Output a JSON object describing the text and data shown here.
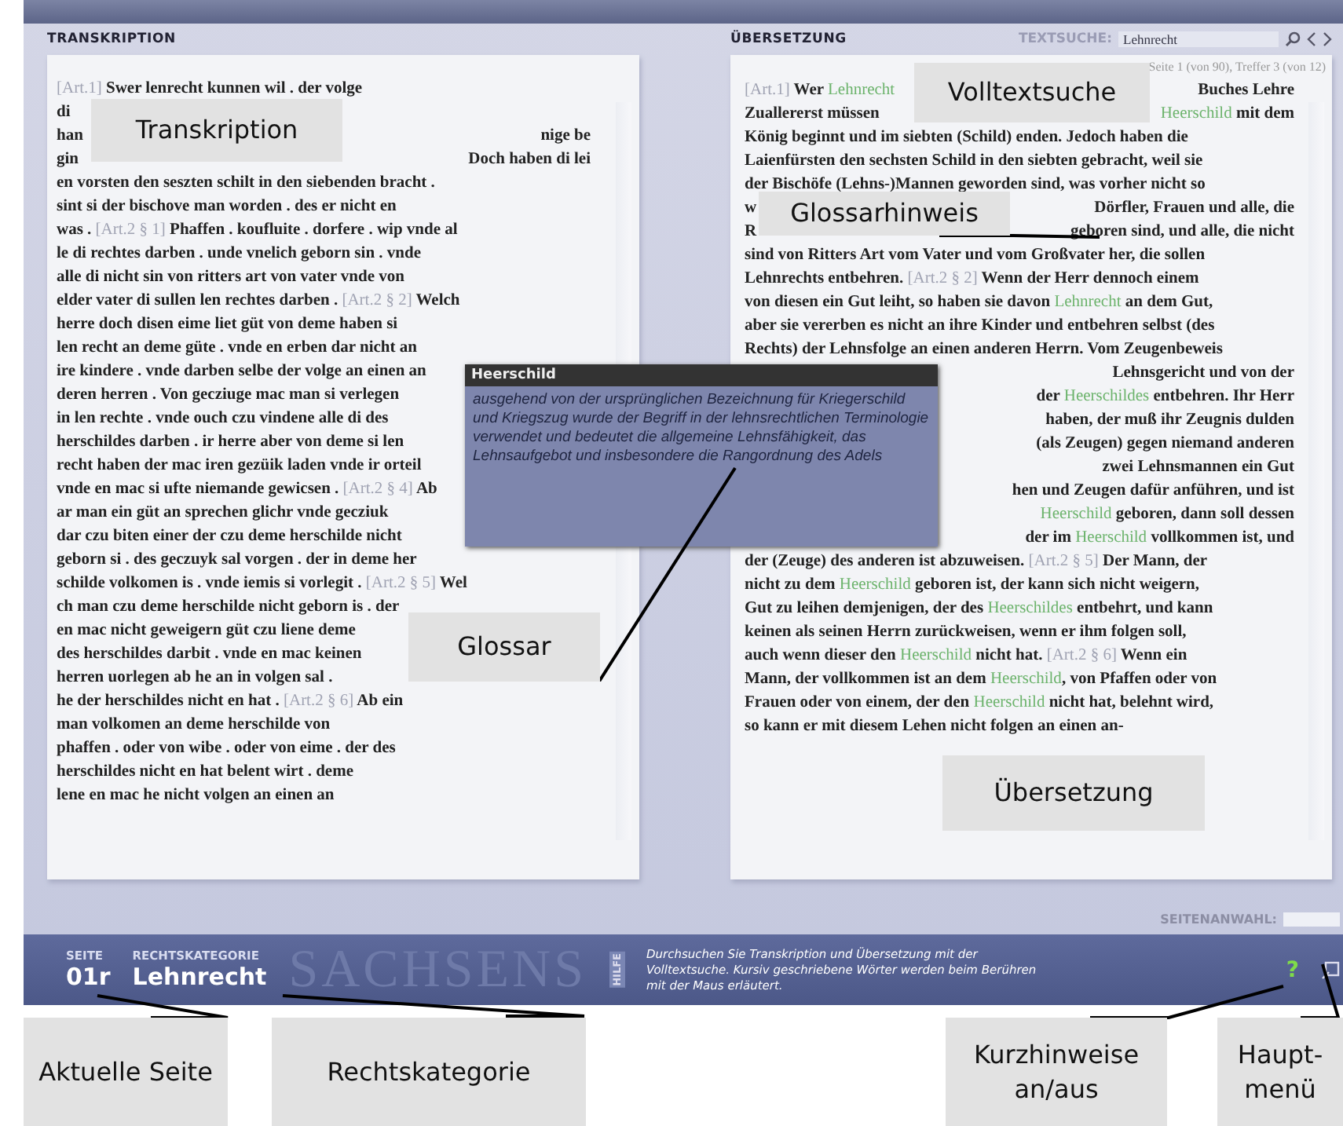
{
  "transcription": {
    "title": "TRANSKRIPTION",
    "lines": [
      [
        {
          "kind": "ref",
          "text": "[Art.1]"
        },
        " Swer lenrecht kunnen wil . der volge"
      ],
      [
        "di",
        {
          "kind": "gap"
        }
      ],
      [
        "han",
        {
          "kind": "gap"
        },
        "nige be"
      ],
      [
        "gin",
        {
          "kind": "gap"
        },
        "Doch haben di lei"
      ],
      [
        "en vorsten den seszten schilt in den siebenden bracht ."
      ],
      [
        "sint si der bischove man worden . des er nicht en"
      ],
      [
        "was . ",
        {
          "kind": "ref",
          "text": "[Art.2 § 1]"
        },
        " Phaffen . koufluite . dorfere . wip vnde al"
      ],
      [
        "le di rechtes darben . unde vnelich geborn sin . vnde"
      ],
      [
        "alle di nicht sin von ritters art von vater vnde von"
      ],
      [
        "elder vater di sullen len rechtes darben . ",
        {
          "kind": "ref",
          "text": "[Art.2 § 2]"
        },
        " Welch"
      ],
      [
        "herre doch disen eime liet güt von deme haben si"
      ],
      [
        "len recht an deme güte . vnde en erben dar nicht an"
      ],
      [
        "ire kindere . vnde darben selbe der volge an einen an"
      ],
      [
        "deren herren . Von gecziuge mac man si verlegen"
      ],
      [
        "in len rechte . vnde ouch czu vindene alle di des"
      ],
      [
        "herschildes darben . ir herre aber von deme si len"
      ],
      [
        "recht haben der mac iren gezüik laden vnde ir orteil"
      ],
      [
        "vnde en mac si ufte niemande gewicsen . ",
        {
          "kind": "ref",
          "text": "[Art.2 § 4]"
        },
        " Ab"
      ],
      [
        "ar man ein güt an sprechen glichr vnde gecziuk"
      ],
      [
        "dar czu biten einer der czu deme herschilde nicht"
      ],
      [
        "geborn si . des geczuyk sal vorgen . der in deme her"
      ],
      [
        "schilde volkomen is . vnde iemis si vorlegit . ",
        {
          "kind": "ref",
          "text": "[Art.2 § 5]"
        },
        " Wel"
      ],
      [
        "ch man czu deme herschilde nicht geborn is . der"
      ],
      [
        "en mac nicht geweigern güt czu liene deme"
      ],
      [
        "des herschildes darbit . vnde en mac keinen"
      ],
      [
        "herren uorlegen ab he an in volgen sal ."
      ],
      [
        "he der herschildes nicht en hat . ",
        {
          "kind": "ref",
          "text": "[Art.2 § 6]"
        },
        " Ab ein"
      ],
      [
        "man volkomen an deme herschilde von"
      ],
      [
        "phaffen . oder von wibe . oder von eime . der des"
      ],
      [
        "herschildes nicht en hat belent wirt . deme"
      ],
      [
        "lene en mac he nicht volgen an einen an"
      ]
    ]
  },
  "translation": {
    "title": "ÜBERSETZUNG",
    "search_label": "TEXTSUCHE:",
    "search_value": "Lehnrecht",
    "hits": "Seite 1 (von 90), Treffer 3 (von 12)",
    "lines": [
      [
        {
          "kind": "ref",
          "text": "[Art.1]"
        },
        " Wer ",
        {
          "kind": "gloss",
          "text": "Lehnrecht"
        },
        {
          "kind": "gap"
        },
        "Buches Lehre"
      ],
      [
        "Zuallererst müssen",
        {
          "kind": "gap"
        },
        {
          "kind": "gloss",
          "text": "Heerschild"
        },
        " mit dem"
      ],
      [
        "König beginnt und im siebten (Schild) enden. Jedoch haben die"
      ],
      [
        "Laienfürsten den sechsten Schild in den siebten gebracht, weil sie"
      ],
      [
        "der Bischöfe (Lehns-)Mannen geworden sind, was vorher nicht so"
      ],
      [
        "w",
        {
          "kind": "gap"
        },
        "Dörfler, Frauen und alle, die"
      ],
      [
        "R",
        {
          "kind": "gap"
        },
        "geboren sind, und alle, die nicht"
      ],
      [
        "sind von Ritters Art vom Vater und vom Großvater her, die sollen"
      ],
      [
        "Lehnrechts entbehren. ",
        {
          "kind": "ref",
          "text": "[Art.2 § 2]"
        },
        " Wenn der Herr dennoch einem"
      ],
      [
        "von diesen ein Gut leiht, so haben sie davon ",
        {
          "kind": "gloss",
          "text": "Lehnrecht"
        },
        " an dem Gut,"
      ],
      [
        "aber sie vererben es nicht an ihre Kinder und entbehren selbst (des"
      ],
      [
        "Rechts) der Lehnsfolge an einen anderen Herrn. Vom Zeugenbeweis"
      ],
      [
        {
          "kind": "gap"
        },
        "Lehnsgericht und von der"
      ],
      [
        {
          "kind": "gap"
        },
        "der ",
        {
          "kind": "gloss",
          "text": "Heerschildes"
        },
        " entbehren. Ihr Herr"
      ],
      [
        {
          "kind": "gap"
        },
        "haben, der muß ihr Zeugnis dulden"
      ],
      [
        {
          "kind": "gap"
        },
        "(als Zeugen) gegen niemand anderen"
      ],
      [
        {
          "kind": "gap"
        },
        "zwei Lehnsmannen ein Gut"
      ],
      [
        {
          "kind": "gap"
        },
        "hen und Zeugen dafür anführen, und ist"
      ],
      [
        {
          "kind": "gap"
        },
        {
          "kind": "gloss",
          "text": "Heerschild"
        },
        " geboren, dann soll dessen"
      ],
      [
        {
          "kind": "gap"
        },
        "der im ",
        {
          "kind": "gloss",
          "text": "Heerschild"
        },
        " vollkommen ist, und"
      ],
      [
        "der (Zeuge) des anderen ist abzuweisen. ",
        {
          "kind": "ref",
          "text": "[Art.2 § 5]"
        },
        " Der Mann, der"
      ],
      [
        "nicht zu dem ",
        {
          "kind": "gloss",
          "text": "Heerschild"
        },
        " geboren ist, der kann sich nicht weigern,"
      ],
      [
        "Gut zu leihen demjenigen, der des ",
        {
          "kind": "gloss",
          "text": "Heerschildes"
        },
        " entbehrt, und kann"
      ],
      [
        "keinen als seinen Herrn zurückweisen, wenn er ihm folgen soll,"
      ],
      [
        "auch wenn dieser den ",
        {
          "kind": "gloss",
          "text": "Heerschild"
        },
        " nicht hat. ",
        {
          "kind": "ref",
          "text": "[Art.2 § 6]"
        },
        " Wenn ein"
      ],
      [
        "Mann, der vollkommen ist an dem ",
        {
          "kind": "gloss",
          "text": "Heerschild"
        },
        ", von Pfaffen oder von"
      ],
      [
        "Frauen oder von einem, der den ",
        {
          "kind": "gloss",
          "text": "Heerschild"
        },
        " nicht hat, belehnt wird,"
      ],
      [
        "so kann er mit diesem Lehen nicht folgen an einen an-"
      ]
    ]
  },
  "glossary_popup": {
    "title": "Heerschild",
    "text": "ausgehend von der ursprünglichen Bezeichnung für Kriegerschild und Kriegszug wurde der Begriff in der lehnsrechtlichen Terminologie verwendet und bedeutet die allgemeine Lehnsfähigkeit, das Lehnsaufgebot und insbesondere die Rangordnung des Adels"
  },
  "page_select": {
    "label": "SEITENANWAHL:"
  },
  "status_bar": {
    "page_label": "SEITE",
    "page": "01r",
    "category_label": "RECHTSKATEGORIE",
    "category": "Lehnrecht",
    "backdrop": "SACHSENS",
    "help_label": "HILFE",
    "help_text": "Durchsuchen Sie Transkription und Übersetzung mit der Volltextsuche. Kursiv geschriebene Wörter werden beim Berühren mit der Maus erläutert.",
    "help_toggle": "?"
  },
  "annotations": [
    {
      "kind": "transcription",
      "text": "Transkription"
    },
    {
      "kind": "search",
      "text": "Volltextsuche"
    },
    {
      "kind": "glossary_hint",
      "text": "Glossarhinweis"
    },
    {
      "kind": "glossary",
      "text": "Glossar"
    },
    {
      "kind": "translation",
      "text": "Übersetzung"
    },
    {
      "kind": "page",
      "text": "Aktuelle Seite"
    },
    {
      "kind": "category",
      "text": "Rechtskategorie"
    },
    {
      "kind": "hints",
      "text": "Kurzhinweise an/aus"
    },
    {
      "kind": "menu",
      "text": "Haupt-menü"
    }
  ]
}
